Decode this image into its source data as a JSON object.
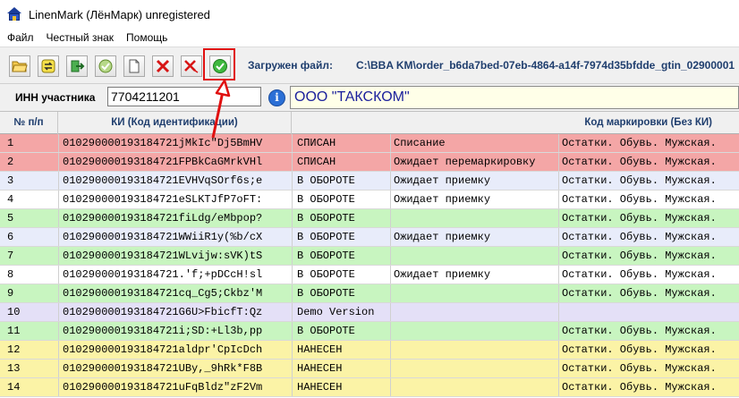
{
  "window": {
    "title": "LinenMark (ЛёнМарк) unregistered"
  },
  "menu": [
    "Файл",
    "Честный знак",
    "Помощь"
  ],
  "toolbar": {
    "buttons": [
      {
        "name": "open-folder-button",
        "icon": "folder-open-icon"
      },
      {
        "name": "exchange-button",
        "icon": "swap-icon"
      },
      {
        "name": "import-button",
        "icon": "import-arrow-icon"
      },
      {
        "name": "confirm-button",
        "icon": "checkmark-icon"
      },
      {
        "name": "new-document-button",
        "icon": "blank-page-icon"
      },
      {
        "name": "delete-button",
        "icon": "red-x-icon"
      },
      {
        "name": "delete-all-button",
        "icon": "red-x-small-icon"
      },
      {
        "name": "verify-button",
        "icon": "green-check-circle-icon"
      }
    ],
    "loaded_label": "Загружен файл:",
    "loaded_path": "C:\\BBA KM\\order_b6da7bed-07eb-4864-a14f-7974d35bfdde_gtin_02900001"
  },
  "inn": {
    "label": "ИНН участника",
    "value": "7704211201",
    "org_name": "ООО \"ТАКСКОМ\""
  },
  "grid": {
    "columns": {
      "num": "№ п/п",
      "ki": "КИ (Код идентификации)",
      "code": "Код маркировки (Без КИ)"
    },
    "rows": [
      {
        "num": "1",
        "ki": "010290000193184721jMkIc\"Dj5BmHV",
        "status": "СПИСАН",
        "desc": "Списание",
        "code": "Остатки. Обувь. Мужская.",
        "color": "#f4a6a6"
      },
      {
        "num": "2",
        "ki": "010290000193184721FPBkCaGMrkVHl",
        "status": "СПИСАН",
        "desc": "Ожидает перемаркировку",
        "code": "Остатки. Обувь. Мужская.",
        "color": "#f4a6a6"
      },
      {
        "num": "3",
        "ki": "010290000193184721EVHVqSOrf6s;e",
        "status": "В ОБОРОТЕ",
        "desc": "Ожидает приемку",
        "code": "Остатки. Обувь. Мужская.",
        "color": "#e8ecfa"
      },
      {
        "num": "4",
        "ki": "010290000193184721eSLKTJfP7oFT:",
        "status": "В ОБОРОТЕ",
        "desc": "Ожидает приемку",
        "code": "Остатки. Обувь. Мужская.",
        "color": "#ffffff"
      },
      {
        "num": "5",
        "ki": "010290000193184721fiLdg/eMbpop?",
        "status": "В ОБОРОТЕ",
        "desc": "",
        "code": "Остатки. Обувь. Мужская.",
        "color": "#c8f5c0"
      },
      {
        "num": "6",
        "ki": "010290000193184721WWiiR1y(%b/cX",
        "status": "В ОБОРОТЕ",
        "desc": "Ожидает приемку",
        "code": "Остатки. Обувь. Мужская.",
        "color": "#e8ecfa"
      },
      {
        "num": "7",
        "ki": "010290000193184721WLvijw:sVK)tS",
        "status": "В ОБОРОТЕ",
        "desc": "",
        "code": "Остатки. Обувь. Мужская.",
        "color": "#c8f5c0"
      },
      {
        "num": "8",
        "ki": "010290000193184721.'f;+pDCcH!sl",
        "status": "В ОБОРОТЕ",
        "desc": "Ожидает приемку",
        "code": "Остатки. Обувь. Мужская.",
        "color": "#ffffff"
      },
      {
        "num": "9",
        "ki": "010290000193184721cq_Cg5;Ckbz'M",
        "status": "В ОБОРОТЕ",
        "desc": "",
        "code": "Остатки. Обувь. Мужская.",
        "color": "#c8f5c0"
      },
      {
        "num": "10",
        "ki": "010290000193184721G6U>FbicfT:Qz",
        "status": "Demo Version",
        "desc": "",
        "code": "",
        "color": "#e4e0f7"
      },
      {
        "num": "11",
        "ki": "010290000193184721i;SD:+Ll3b,pp",
        "status": "В ОБОРОТЕ",
        "desc": "",
        "code": "Остатки. Обувь. Мужская.",
        "color": "#c8f5c0"
      },
      {
        "num": "12",
        "ki": "010290000193184721aldpr'CpIcDch",
        "status": "НАНЕСЕН",
        "desc": "",
        "code": "Остатки. Обувь. Мужская.",
        "color": "#fbf3a6"
      },
      {
        "num": "13",
        "ki": "010290000193184721UBy,_9hRk*F8B",
        "status": "НАНЕСЕН",
        "desc": "",
        "code": "Остатки. Обувь. Мужская.",
        "color": "#fbf3a6"
      },
      {
        "num": "14",
        "ki": "010290000193184721uFqBldz\"zF2Vm",
        "status": "НАНЕСЕН",
        "desc": "",
        "code": "Остатки. Обувь. Мужская.",
        "color": "#fbf3a6"
      }
    ]
  }
}
